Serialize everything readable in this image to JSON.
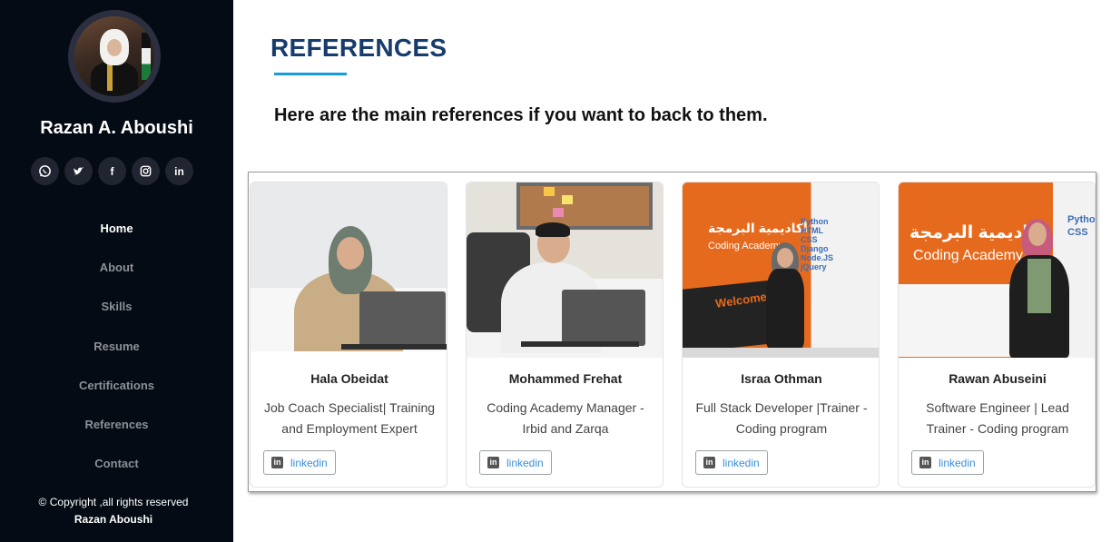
{
  "sidebar": {
    "name": "Razan A. Aboushi",
    "social": [
      {
        "icon": "whatsapp-icon"
      },
      {
        "icon": "twitter-icon"
      },
      {
        "icon": "facebook-icon",
        "glyph": "f"
      },
      {
        "icon": "instagram-icon"
      },
      {
        "icon": "linkedin-icon",
        "glyph": "in"
      }
    ],
    "nav": [
      "Home",
      "About",
      "Skills",
      "Resume",
      "Certifications",
      "References",
      "Contact"
    ],
    "active_nav": "Home",
    "copyright": "© Copyright ,all rights reserved",
    "copyright_owner": "Razan Aboushi"
  },
  "main": {
    "title": "REFERENCES",
    "intro": "Here are the main references if you want to back to them.",
    "cards": [
      {
        "name": "Hala Obeidat",
        "role_line1": "Job Coach Specialist| Training",
        "role_line2": "and Employment Expert",
        "link": "linkedin"
      },
      {
        "name": "Mohammed Frehat",
        "role_line1": "Coding Academy Manager -",
        "role_line2": "Irbid and Zarqa",
        "link": "linkedin"
      },
      {
        "name": "Israa Othman",
        "role_line1": "Full Stack Developer |Trainer -",
        "role_line2": "Coding program",
        "link": "linkedin"
      },
      {
        "name": "Rawan Abuseini",
        "role_line1": "Software Engineer | Lead",
        "role_line2": "Trainer - Coding program",
        "link": "linkedin"
      }
    ],
    "photo_texts": {
      "arabic": "أكاديمية البرمجة",
      "coding_academy": "Coding Academy",
      "welcome": "Welcome",
      "wall_words": [
        "Python",
        "CSS",
        "Django",
        "Node.JS",
        "jQuery",
        "HTML"
      ]
    }
  },
  "colors": {
    "sidebar_bg": "#040b14",
    "title": "#173b6c",
    "accent": "#149ddd",
    "academy_orange": "#e66a1d"
  }
}
